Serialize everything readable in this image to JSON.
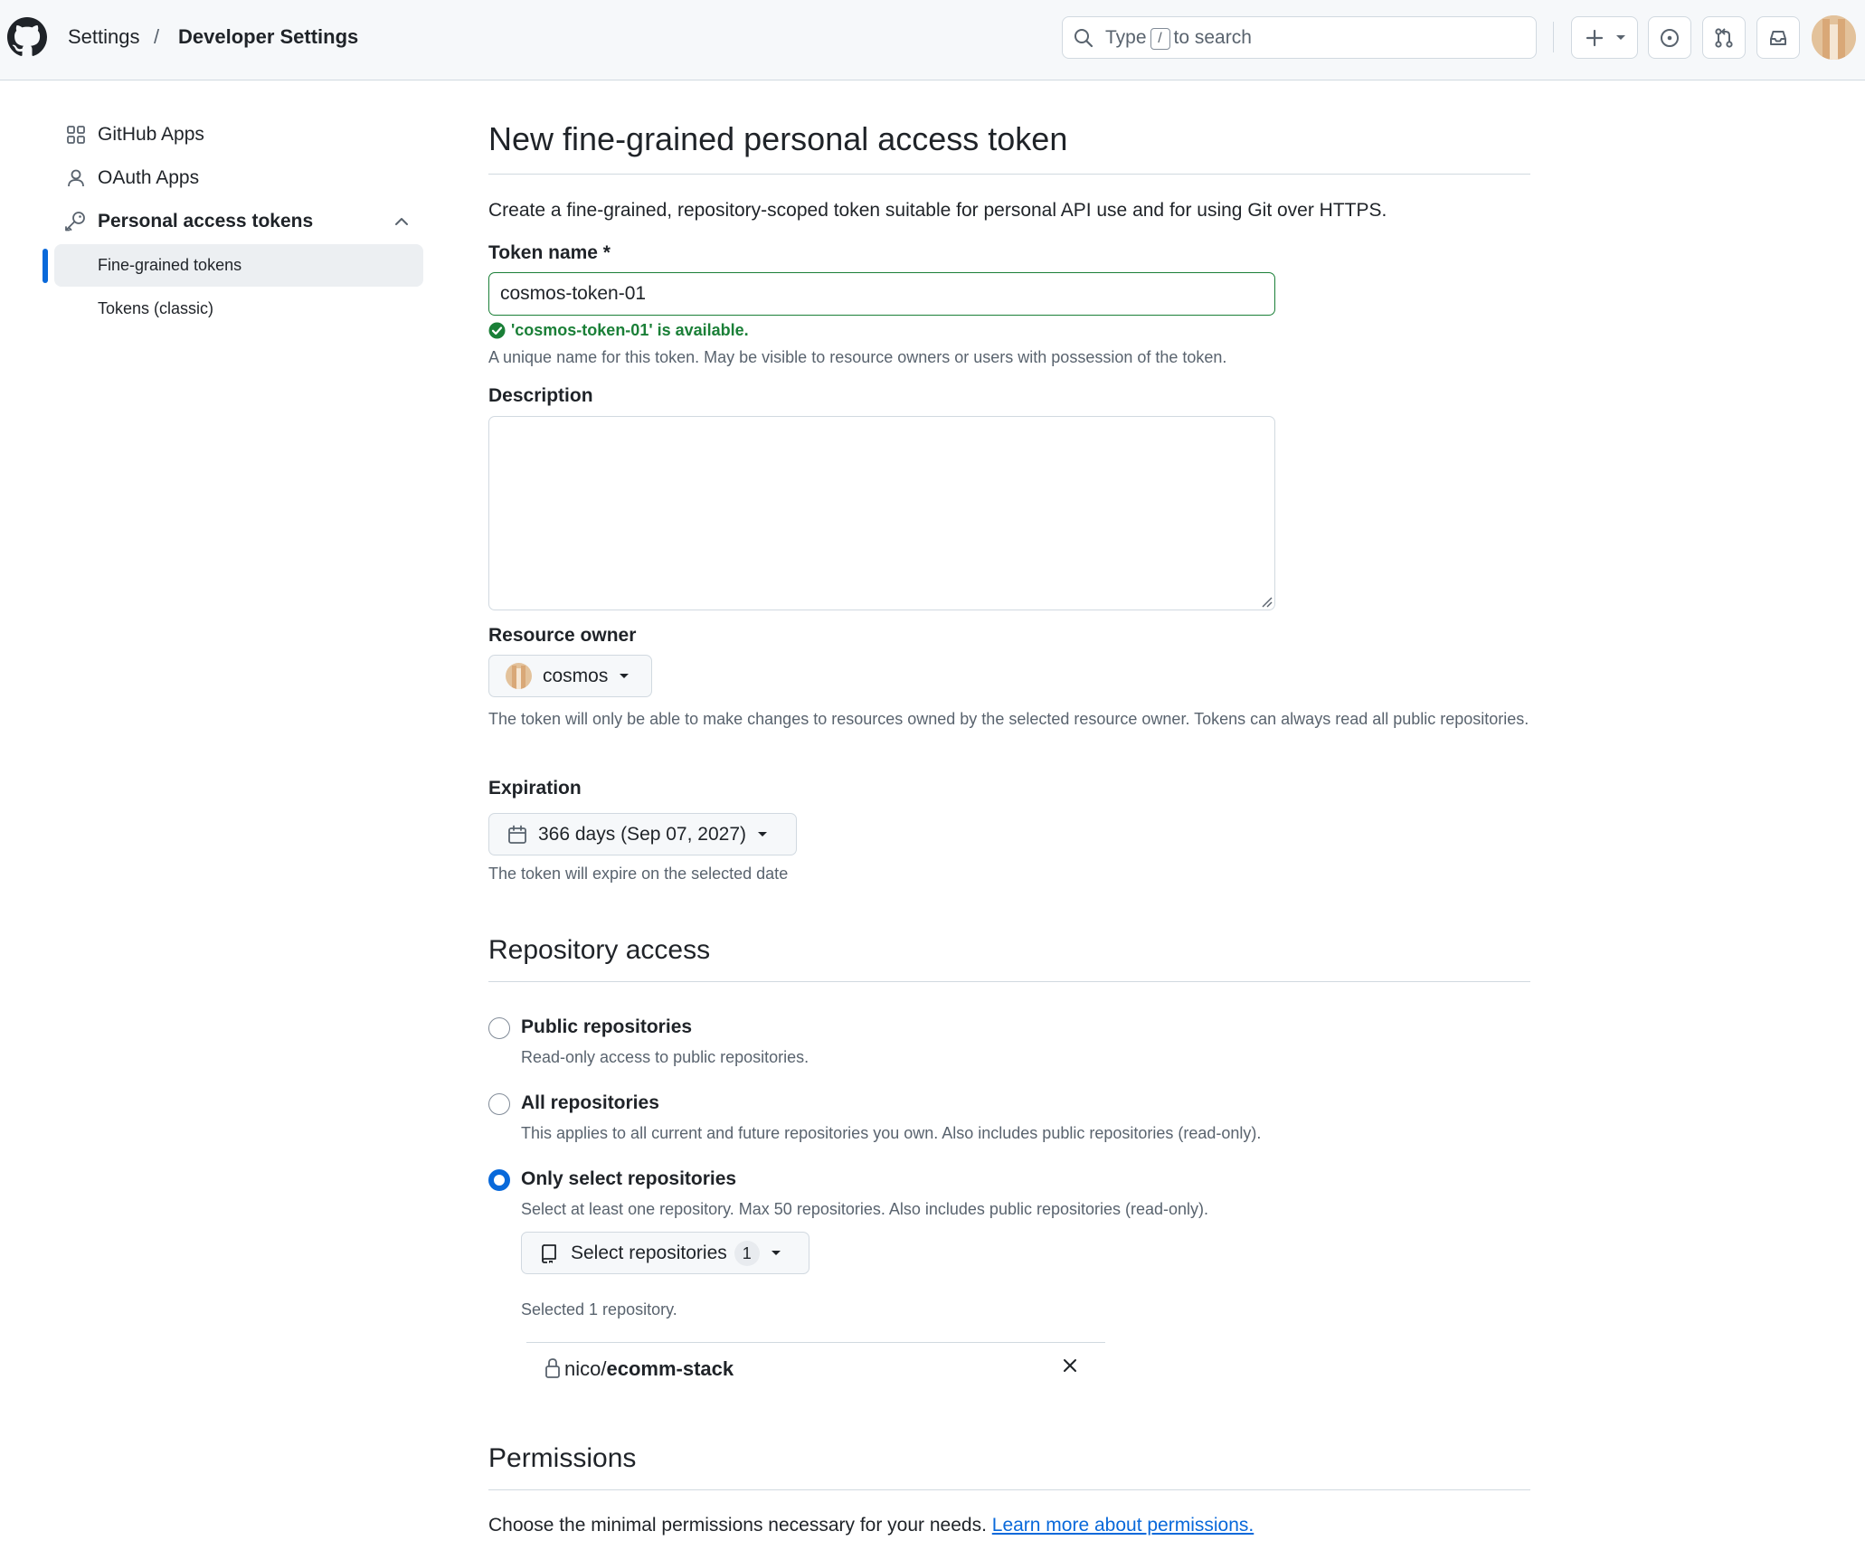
{
  "header": {
    "breadcrumb": [
      "Settings",
      "/",
      "Developer Settings"
    ],
    "search": {
      "prefix": "Type",
      "key": "/",
      "suffix": "to search"
    }
  },
  "sidebar": {
    "items": [
      {
        "label": "GitHub Apps",
        "icon": "apps-icon"
      },
      {
        "label": "OAuth Apps",
        "icon": "person-icon"
      },
      {
        "label": "Personal access tokens",
        "icon": "key-icon",
        "expanded": true
      }
    ],
    "subitems": [
      {
        "label": "Fine-grained tokens",
        "active": true
      },
      {
        "label": "Tokens (classic)",
        "active": false
      }
    ]
  },
  "main": {
    "title": "New fine-grained personal access token",
    "intro": "Create a fine-grained, repository-scoped token suitable for personal API use and for using Git over HTTPS.",
    "token_name": {
      "label": "Token name *",
      "value": "cosmos-token-01",
      "status": "'cosmos-token-01' is available.",
      "help": "A unique name for this token. May be visible to resource owners or users with possession of the token."
    },
    "description": {
      "label": "Description",
      "value": ""
    },
    "resource_owner": {
      "label": "Resource owner",
      "value": "cosmos",
      "help": "The token will only be able to make changes to resources owned by the selected resource owner. Tokens can always read all public repositories."
    },
    "expiration": {
      "label": "Expiration",
      "value": "366 days (Sep 07, 2027)",
      "help": "The token will expire on the selected date"
    },
    "repository_access": {
      "heading": "Repository access",
      "options": [
        {
          "label": "Public repositories",
          "desc": "Read-only access to public repositories.",
          "checked": false
        },
        {
          "label": "All repositories",
          "desc": "This applies to all current and future repositories you own. Also includes public repositories (read-only).",
          "checked": false
        },
        {
          "label": "Only select repositories",
          "desc": "Select at least one repository. Max 50 repositories. Also includes public repositories (read-only).",
          "checked": true
        }
      ],
      "select_button": "Select repositories",
      "select_count": "1",
      "selected_summary": "Selected 1 repository.",
      "selected_repo": {
        "owner": "nico/",
        "name": "ecomm-stack"
      }
    },
    "permissions": {
      "heading": "Permissions",
      "text": "Choose the minimal permissions necessary for your needs.",
      "link": "Learn more about permissions."
    }
  },
  "colors": {
    "accent": "#0969da",
    "success": "#1a7f37",
    "border": "#d1d9e0",
    "muted_text": "#59636e"
  }
}
